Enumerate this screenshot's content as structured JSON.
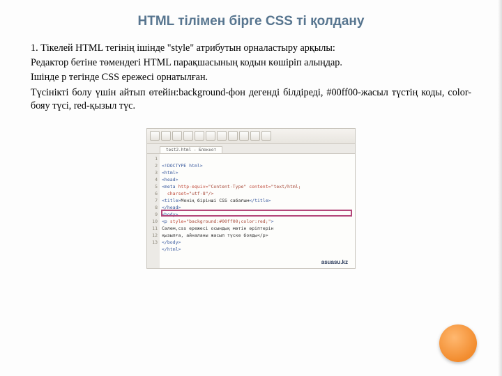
{
  "title": "HTML тілімен бірге CSS ті қолдану",
  "body": {
    "p1": "1. Тікелей HTML тегінің ішінде \"style\" атрибутын орналастыру арқылы:",
    "p2": "Редактор бетіне төмендегі HTML парақшасының кодын көшіріп алыңдар.",
    "p3": "Ішінде p тегінде CSS ережесі орнатылған.",
    "p4": "Түсінікті болу үшін айтып өтейін:background-фон дегенді білдіреді, #00ff00-жасыл түстің коды, color-бояу түсі, red-қызыл түс."
  },
  "editor": {
    "tab": "test2.html - Блокнот",
    "lines": [
      "1",
      "2",
      "3",
      "4",
      "",
      "5",
      "6",
      "7",
      "8",
      "9",
      "10",
      "",
      "11",
      "12",
      "13"
    ],
    "code": {
      "l1": "<!DOCTYPE html>",
      "l2": "<html>",
      "l3": "<head>",
      "l4a": "<meta ",
      "l4b": "http-equiv=",
      "l4c": "\"Content-Type\" ",
      "l4d": "content=",
      "l4e": "\"text/html;",
      "l4f": "charset=",
      "l4g": "\"utf-8\"/>",
      "l5a": "<title>",
      "l5b": "Менің бірінші CSS сабағым",
      "l5c": "</title>",
      "l6": "</head>",
      "l7": "<body>",
      "l8a": "<p ",
      "l8b": "style=",
      "l8c": "\"background:#00ff00;color:red;\"",
      "l8d": ">",
      "l9": "Сәлем,css ережесі осындық мәтін әріптерін",
      "l10": "қызылға, айналаны жасыл түске бояды</p>",
      "l11": "</body>",
      "l12": "</html>"
    },
    "watermark": "asuasu.kz"
  }
}
